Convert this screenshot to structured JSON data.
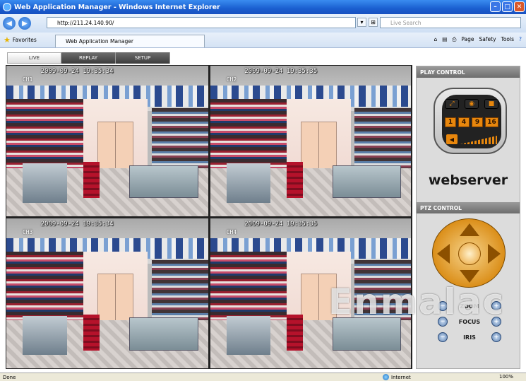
{
  "window": {
    "title": "Web Application Manager - Windows Internet Explorer"
  },
  "address": {
    "url": "http://211.24.140.90/",
    "search_placeholder": "Live Search"
  },
  "favorites": {
    "label": "Favorites",
    "tab_title": "Web Application Manager"
  },
  "toolbar": {
    "page": "Page",
    "safety": "Safety",
    "tools": "Tools"
  },
  "app_tabs": [
    {
      "label": "LIVE",
      "active": true
    },
    {
      "label": "REPLAY",
      "active": false
    },
    {
      "label": "SETUP",
      "active": false
    }
  ],
  "cameras": [
    {
      "timestamp": "2009-09-24 19:35:34",
      "channel": "CH1",
      "selected": true
    },
    {
      "timestamp": "2009-09-24 19:35:35",
      "channel": "CH2",
      "selected": false
    },
    {
      "timestamp": "2009-09-24 19:35:34",
      "channel": "CH3",
      "selected": false
    },
    {
      "timestamp": "2009-09-24 19:35:35",
      "channel": "CH4",
      "selected": false
    }
  ],
  "play_control": {
    "title": "PLAY CONTROL",
    "split_options": [
      "1",
      "4",
      "9",
      "16"
    ],
    "icons": [
      "fullscreen-icon",
      "snapshot-icon",
      "record-icon",
      "volume-icon"
    ]
  },
  "brand": "webserver",
  "ptz_control": {
    "title": "PTZ CONTROL",
    "zoom_label": "ZOOM",
    "focus_label": "FOCUS",
    "iris_label": "IRIS"
  },
  "watermark": "Enmalac",
  "status": {
    "left": "Done",
    "zone": "Internet",
    "zoom": "100%"
  }
}
